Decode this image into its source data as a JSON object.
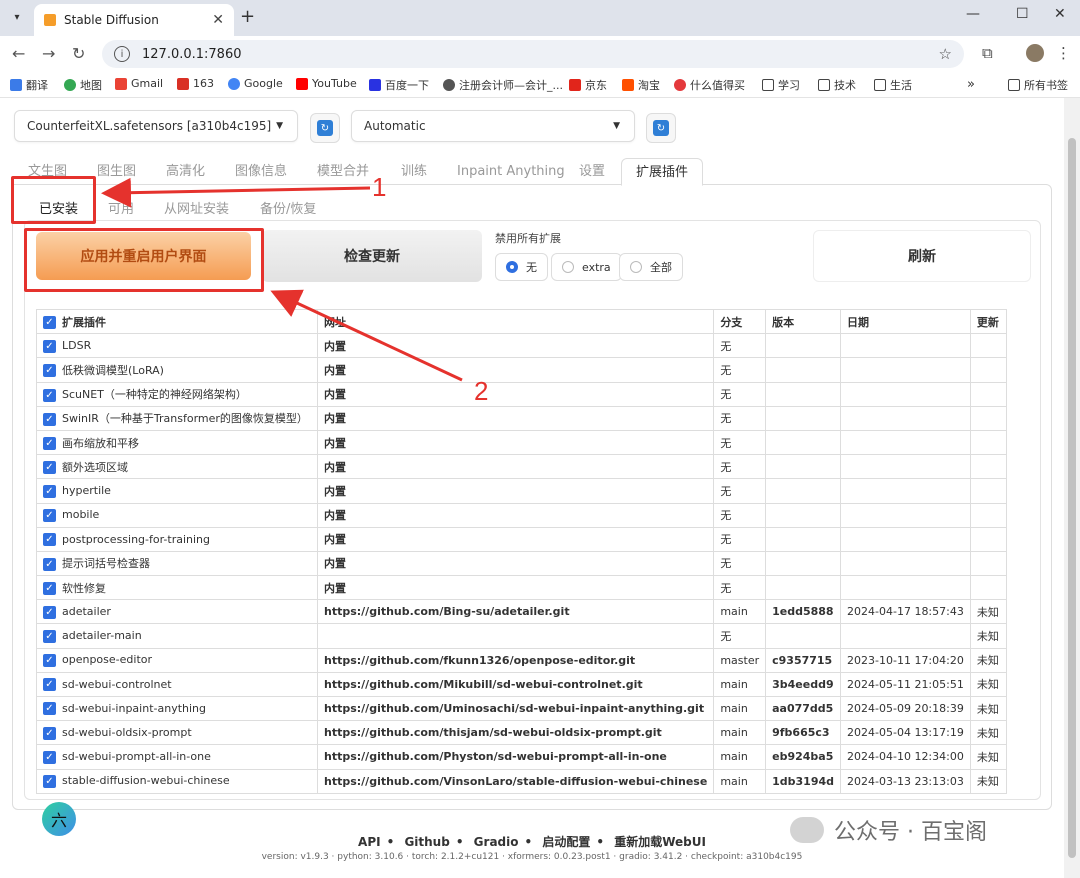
{
  "browser": {
    "tab_title": "Stable Diffusion",
    "url": "127.0.0.1:7860",
    "bookmarks": [
      "翻译",
      "地图",
      "Gmail",
      "163",
      "Google",
      "YouTube",
      "百度一下",
      "注册会计师—会计_...",
      "京东",
      "淘宝",
      "什么值得买",
      "学习",
      "技术",
      "生活"
    ],
    "all_bookmarks": "所有书签"
  },
  "top": {
    "checkpoint_value": "CounterfeitXL.safetensors [a310b4c195]",
    "vae_value": "Automatic"
  },
  "main_tabs": [
    "文生图",
    "图生图",
    "高清化",
    "图像信息",
    "模型合并",
    "训练",
    "Inpaint Anything",
    "设置",
    "扩展插件"
  ],
  "sub_tabs": [
    "已安装",
    "可用",
    "从网址安装",
    "备份/恢复"
  ],
  "buttons": {
    "apply": "应用并重启用户界面",
    "check": "检查更新",
    "refresh": "刷新"
  },
  "disable": {
    "label": "禁用所有扩展",
    "options": [
      "无",
      "extra",
      "全部"
    ]
  },
  "table": {
    "headers": [
      "扩展插件",
      "网址",
      "分支",
      "版本",
      "日期",
      "更新"
    ],
    "rows": [
      [
        "LDSR",
        "内置",
        "无",
        "",
        "",
        ""
      ],
      [
        "低秩微调模型(LoRA)",
        "内置",
        "无",
        "",
        "",
        ""
      ],
      [
        "ScuNET（一种特定的神经网络架构）",
        "内置",
        "无",
        "",
        "",
        ""
      ],
      [
        "SwinIR（一种基于Transformer的图像恢复模型）",
        "内置",
        "无",
        "",
        "",
        ""
      ],
      [
        "画布缩放和平移",
        "内置",
        "无",
        "",
        "",
        ""
      ],
      [
        "额外选项区域",
        "内置",
        "无",
        "",
        "",
        ""
      ],
      [
        "hypertile",
        "内置",
        "无",
        "",
        "",
        ""
      ],
      [
        "mobile",
        "内置",
        "无",
        "",
        "",
        ""
      ],
      [
        "postprocessing-for-training",
        "内置",
        "无",
        "",
        "",
        ""
      ],
      [
        "提示词括号检查器",
        "内置",
        "无",
        "",
        "",
        ""
      ],
      [
        "软性修复",
        "内置",
        "无",
        "",
        "",
        ""
      ],
      [
        "adetailer",
        "https://github.com/Bing-su/adetailer.git",
        "main",
        "1edd5888",
        "2024-04-17 18:57:43",
        "未知"
      ],
      [
        "adetailer-main",
        "",
        "无",
        "",
        "",
        "未知"
      ],
      [
        "openpose-editor",
        "https://github.com/fkunn1326/openpose-editor.git",
        "master",
        "c9357715",
        "2023-10-11 17:04:20",
        "未知"
      ],
      [
        "sd-webui-controlnet",
        "https://github.com/Mikubill/sd-webui-controlnet.git",
        "main",
        "3b4eedd9",
        "2024-05-11 21:05:51",
        "未知"
      ],
      [
        "sd-webui-inpaint-anything",
        "https://github.com/Uminosachi/sd-webui-inpaint-anything.git",
        "main",
        "aa077dd5",
        "2024-05-09 20:18:39",
        "未知"
      ],
      [
        "sd-webui-oldsix-prompt",
        "https://github.com/thisjam/sd-webui-oldsix-prompt.git",
        "main",
        "9fb665c3",
        "2024-05-04 13:17:19",
        "未知"
      ],
      [
        "sd-webui-prompt-all-in-one",
        "https://github.com/Physton/sd-webui-prompt-all-in-one",
        "main",
        "eb924ba5",
        "2024-04-10 12:34:00",
        "未知"
      ],
      [
        "stable-diffusion-webui-chinese",
        "https://github.com/VinsonLaro/stable-diffusion-webui-chinese",
        "main",
        "1db3194d",
        "2024-03-13 23:13:03",
        "未知"
      ]
    ]
  },
  "annotations": {
    "one": "1",
    "two": "2"
  },
  "footer": {
    "links": [
      "API",
      "Github",
      "Gradio",
      "启动配置",
      "重新加载WebUI"
    ],
    "version": "version: v1.9.3 · python: 3.10.6 · torch: 2.1.2+cu121 · xformers: 0.0.23.post1 · gradio: 3.41.2 · checkpoint: a310b4c195"
  },
  "fab_label": "六",
  "watermark": "公众号 · 百宝阁",
  "colors": {
    "accent": "#2f6fe0",
    "annotation": "#e5322d",
    "apply_btn": "#f59c52"
  }
}
